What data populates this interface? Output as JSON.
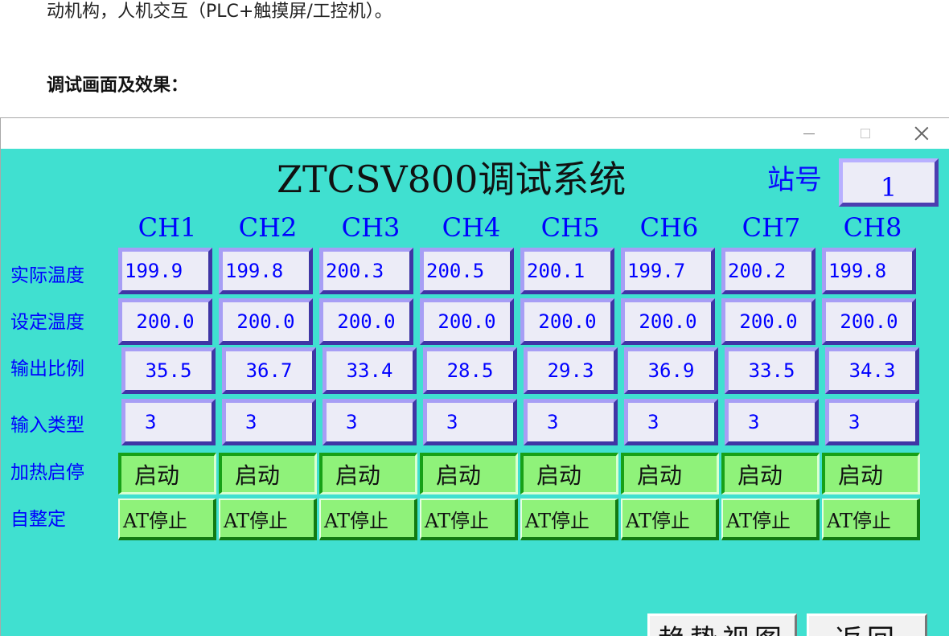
{
  "document": {
    "intro_line": "动机构，人机交互（PLC+触摸屏/工控机）。",
    "heading": "调试画面及效果："
  },
  "window": {
    "title": "ZTCSV800调试系统",
    "station_label": "站号",
    "station_value": "1",
    "controls": {
      "minimize": "—",
      "maximize": "□",
      "close": "×"
    }
  },
  "channels": [
    "CH1",
    "CH2",
    "CH3",
    "CH4",
    "CH5",
    "CH6",
    "CH7",
    "CH8"
  ],
  "row_labels": {
    "actual_temp": "实际温度",
    "set_temp": "设定温度",
    "output_ratio": "输出比例",
    "input_type": "输入类型",
    "heat_start_stop": "加热启停",
    "autotune": "自整定"
  },
  "values": {
    "actual_temp": [
      "199.9",
      "199.8",
      "200.3",
      "200.5",
      "200.1",
      "199.7",
      "200.2",
      "199.8"
    ],
    "set_temp": [
      "200.0",
      "200.0",
      "200.0",
      "200.0",
      "200.0",
      "200.0",
      "200.0",
      "200.0"
    ],
    "output_ratio": [
      "35.5",
      "36.7",
      "33.4",
      "28.5",
      "29.3",
      "36.9",
      "33.5",
      "34.3"
    ],
    "input_type": [
      "3",
      "3",
      "3",
      "3",
      "3",
      "3",
      "3",
      "3"
    ],
    "heat_start_stop": [
      "启动",
      "启动",
      "启动",
      "启动",
      "启动",
      "启动",
      "启动",
      "启动"
    ],
    "autotune": [
      "AT停止",
      "AT停止",
      "AT停止",
      "AT停止",
      "AT停止",
      "AT停止",
      "AT停止",
      "AT停止"
    ]
  },
  "bottom_buttons": {
    "trend_view": "趋势视图",
    "back": "返回"
  },
  "colors": {
    "window_background": "#40e0d0",
    "label_blue": "#0000ff",
    "button_green": "#8ff27a",
    "box_border": "#6a5ed0"
  }
}
